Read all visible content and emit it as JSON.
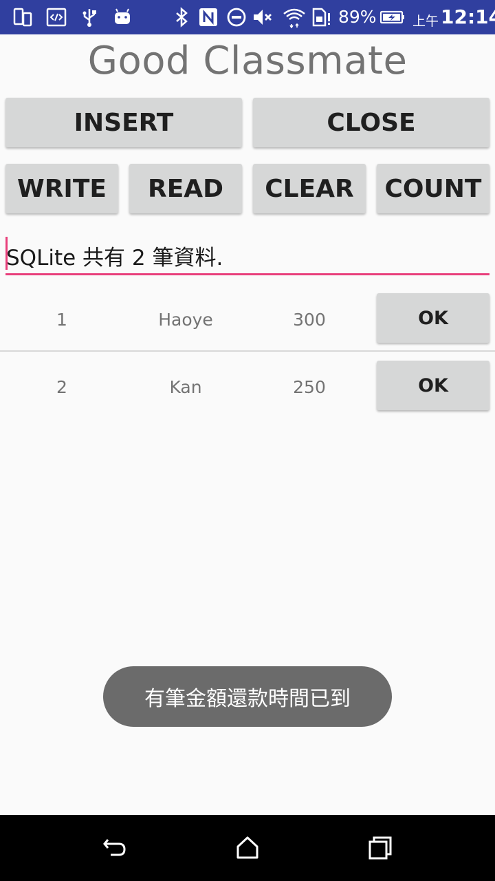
{
  "status_bar": {
    "battery_percent": "89%",
    "ampm": "上午",
    "time": "12:14",
    "icons": [
      "device-icon",
      "code-icon",
      "usb-icon",
      "android-icon",
      "bluetooth-icon",
      "nfc-icon",
      "do-not-disturb-icon",
      "mute-icon",
      "wifi-icon",
      "sim-alert-icon",
      "battery-charging-icon"
    ]
  },
  "app": {
    "title": "Good Classmate"
  },
  "buttons": {
    "insert": "INSERT",
    "close": "CLOSE",
    "write": "WRITE",
    "read": "READ",
    "clear": "CLEAR",
    "count": "COUNT"
  },
  "edit_text": {
    "value": "SQLite 共有 2 筆資料."
  },
  "records": [
    {
      "id": "1",
      "name": "Haoye",
      "amount": "300",
      "action": "OK"
    },
    {
      "id": "2",
      "name": "Kan",
      "amount": "250",
      "action": "OK"
    }
  ],
  "toast": {
    "message": "有筆金額還款時間已到"
  },
  "nav_bar": {
    "icons": [
      "back-icon",
      "home-icon",
      "recents-icon"
    ]
  },
  "colors": {
    "status_bar": "#303f9f",
    "accent": "#e83e7a",
    "button": "#d6d7d7",
    "toast": "#6b6b6b",
    "nav_bar": "#000000"
  }
}
